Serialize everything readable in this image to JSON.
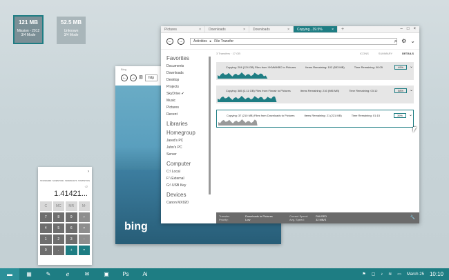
{
  "desktop": {
    "tiles": [
      {
        "size": "121 MB",
        "name": "Mission - 2012",
        "sub": "3/4 Mode"
      },
      {
        "size": "52.5 MB",
        "name": "Unknown",
        "sub": "3/4 Mode"
      }
    ]
  },
  "calculator": {
    "modes": [
      "STANDARD",
      "SCIENTIFIC",
      "WORKDAYS",
      "STATISTICS"
    ],
    "history": "√2",
    "display": "1.41421...",
    "keys": [
      "C",
      "MC",
      "MR",
      "M-",
      "7",
      "8",
      "9",
      "÷",
      "4",
      "5",
      "6",
      "×",
      "1",
      "2",
      "3",
      "-",
      "0",
      ".",
      "+",
      "="
    ]
  },
  "ie": {
    "title": "Bing",
    "address": "http",
    "logo": "bing"
  },
  "explorer": {
    "tabs": [
      {
        "label": "Pictures"
      },
      {
        "label": "Downloads"
      },
      {
        "label": "Downloads"
      },
      {
        "label": "Copying...39.5%"
      }
    ],
    "plus": "+",
    "window_controls": [
      "–",
      "□",
      "×"
    ],
    "breadcrumb": [
      "Activities",
      "File Transfer"
    ],
    "sidebar": {
      "favorites_h": "Favorites",
      "favorites": [
        "Documents",
        "Downloads",
        "Desktop",
        "Projects",
        "SkyDrive ✔",
        "Music",
        "Pictures",
        "Recent"
      ],
      "libraries_h": "Libraries",
      "homegroup_h": "Homegroup",
      "homegroup": [
        "Jared's PC",
        "Juhn's PC",
        "Server"
      ],
      "computer_h": "Computer",
      "computer": [
        "C:\\ Local",
        "F:\\ External",
        "G:\\ USB Key"
      ],
      "devices_h": "Devices",
      "devices": [
        "Canon MX920"
      ]
    },
    "header": {
      "left": "3 Transfers · 17 GB",
      "views": [
        "ICONS",
        "SUMMARY",
        "DETAILS"
      ]
    },
    "jobs": [
      {
        "copy": "Copying: 204 (124 GB) Files from YKMWKBC to Pictures",
        "items": "Items Remaining: 102 (553 MB)",
        "time": "Time Remaining: 00:05",
        "pct": "49%",
        "progress": 0.49
      },
      {
        "copy": "Copying: 385 (2.11 GB) Files from Finnair to Pictures",
        "items": "Items Remaining: 216 (986 MB)",
        "time": "Time Remaining: 03:12",
        "pct": "58%",
        "progress": 0.58
      },
      {
        "copy": "Copying: 37 (210 MB) Files from Downloads to Pictures",
        "items": "Items Remaining: 21 (221 MB)",
        "time": "Time Remaining: 01:15",
        "pct": "39%",
        "progress": 0.39
      }
    ],
    "status": {
      "transfer_l": "Transfer:",
      "transfer_v": "Downloads to Pictures",
      "cur_l": "Current Speed:",
      "cur_v": "PAUSED",
      "prio_l": "Priority:",
      "prio_v": "Low",
      "avg_l": "Avg. Speed:",
      "avg_v": "32 MB/S"
    }
  },
  "taskbar": {
    "icons": [
      "folder",
      "calculator",
      "wrench",
      "ie",
      "mail",
      "photos",
      "photoshop",
      "illustrator"
    ],
    "date": "March 25",
    "time": "10:10"
  },
  "colors": {
    "accent": "#1e7d83"
  }
}
